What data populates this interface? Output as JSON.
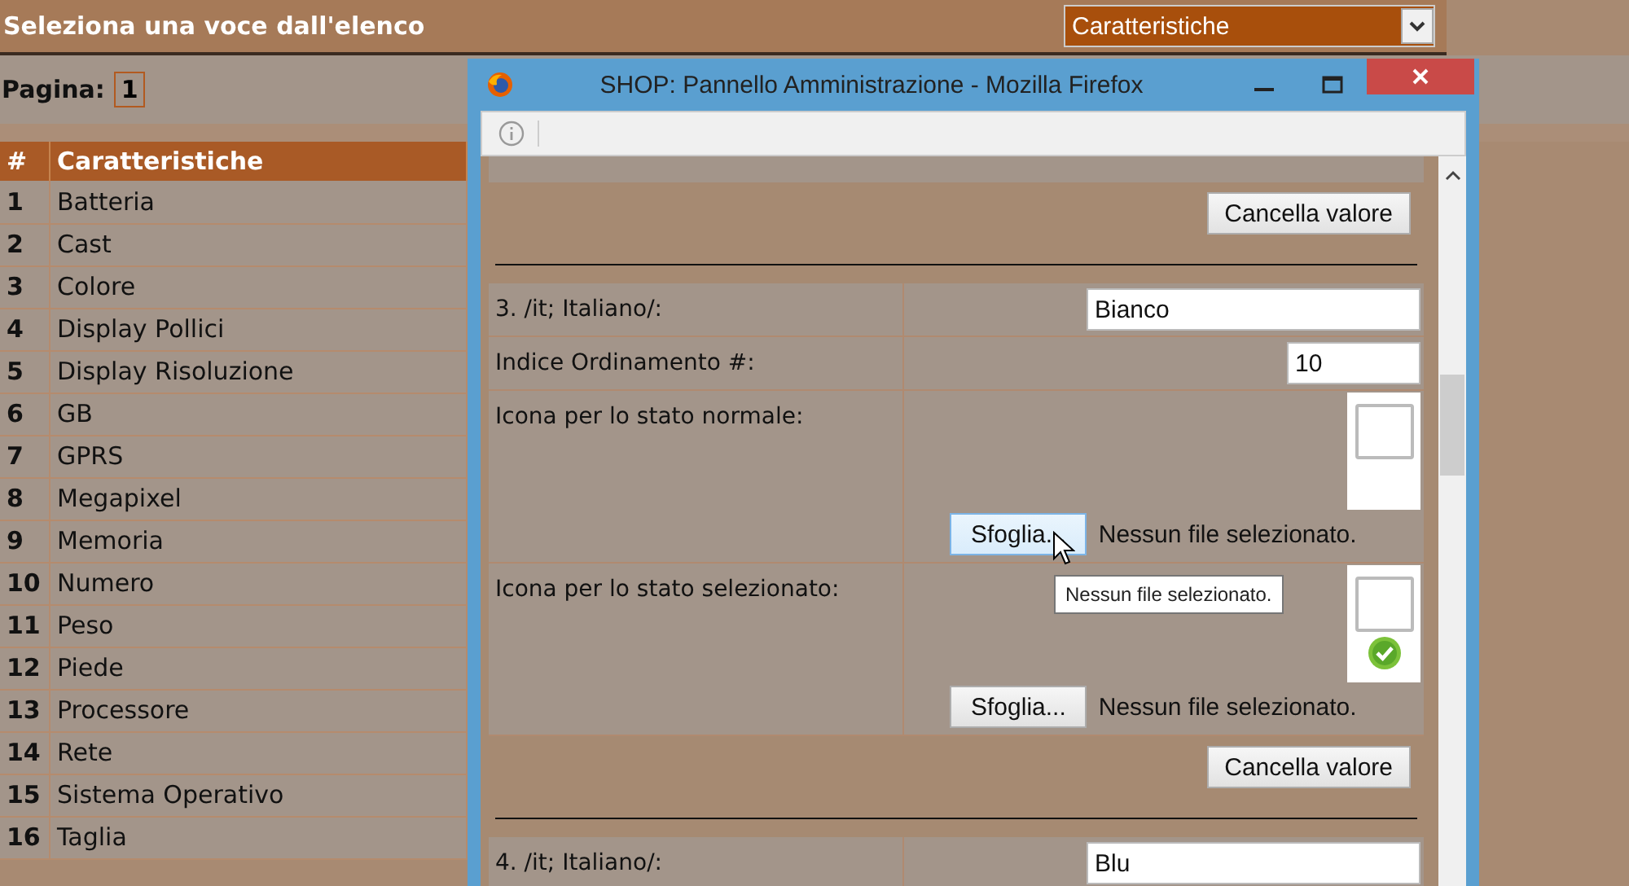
{
  "page": {
    "title": "Seleziona una voce dall'elenco",
    "select": {
      "value": "Caratteristiche"
    },
    "pagination": {
      "label": "Pagina:",
      "pages": [
        {
          "label": "1",
          "selected": true
        }
      ]
    },
    "table": {
      "columns": [
        "#",
        "Caratteristiche"
      ],
      "rows": [
        {
          "num": "1",
          "name": "Batteria"
        },
        {
          "num": "2",
          "name": "Cast"
        },
        {
          "num": "3",
          "name": "Colore"
        },
        {
          "num": "4",
          "name": "Display Pollici"
        },
        {
          "num": "5",
          "name": "Display Risoluzione"
        },
        {
          "num": "6",
          "name": "GB"
        },
        {
          "num": "7",
          "name": "GPRS"
        },
        {
          "num": "8",
          "name": "Megapixel"
        },
        {
          "num": "9",
          "name": "Memoria"
        },
        {
          "num": "10",
          "name": "Numero"
        },
        {
          "num": "11",
          "name": "Peso"
        },
        {
          "num": "12",
          "name": "Piede"
        },
        {
          "num": "13",
          "name": "Processore"
        },
        {
          "num": "14",
          "name": "Rete"
        },
        {
          "num": "15",
          "name": "Sistema Operativo"
        },
        {
          "num": "16",
          "name": "Taglia"
        }
      ]
    }
  },
  "popup": {
    "title": "SHOP: Pannello Amministrazione - Mozilla Firefox",
    "form": [
      {
        "kind": "clear",
        "button": "Cancella valore"
      },
      {
        "kind": "divider"
      },
      {
        "kind": "text",
        "label": "3. /it; Italiano/:",
        "value": "Bianco"
      },
      {
        "kind": "number",
        "label": "Indice Ordinamento #:",
        "value": "10"
      },
      {
        "kind": "file",
        "label": "Icona per lo stato normale:",
        "button": "Sfoglia...",
        "status": "Nessun file selezionato.",
        "hovered": true,
        "checked": false
      },
      {
        "kind": "file",
        "label": "Icona per lo stato selezionato:",
        "button": "Sfoglia...",
        "status": "Nessun file selezionato.",
        "hovered": false,
        "checked": true
      },
      {
        "kind": "clear",
        "button": "Cancella valore"
      },
      {
        "kind": "divider"
      },
      {
        "kind": "text",
        "label": "4. /it; Italiano/:",
        "value": "Blu"
      }
    ],
    "tooltip": {
      "text": "Nessun file selezionato."
    }
  }
}
